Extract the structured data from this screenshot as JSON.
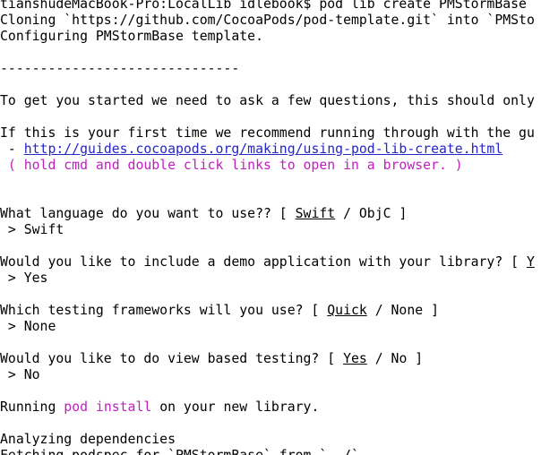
{
  "terminal": {
    "prompt": "tianshudeMacBook-Pro:LocalLib idlebook$ pod lib create PMStormBase",
    "cloning": "Cloning `https://github.com/CocoaPods/pod-template.git` into `PMSto",
    "configuring": "Configuring PMStormBase template.",
    "separator": "------------------------------",
    "intro": "To get you started we need to ask a few questions, this should only",
    "first_time": "If this is your first time we recommend running through with the gu",
    "guide_dash": " - ",
    "guide_link": "http://guides.cocoapods.org/making/using-pod-lib-create.html",
    "hint": " ( hold cmd and double click links to open in a browser. )",
    "q_language": {
      "prefix": "What language do you want to use?? [ ",
      "default": "Swift",
      "suffix": " / ObjC ]",
      "answer": " > Swift"
    },
    "q_demo": {
      "prefix": "Would you like to include a demo application with your library? [ ",
      "default": "Y",
      "answer": " > Yes"
    },
    "q_testing": {
      "prefix": "Which testing frameworks will you use? [ ",
      "default": "Quick",
      "suffix": " / None ]",
      "answer": " > None"
    },
    "q_viewtest": {
      "prefix": "Would you like to do view based testing? [ ",
      "default": "Yes",
      "suffix": " / No ]",
      "answer": " > No"
    },
    "running": {
      "prefix": "Running ",
      "command": "pod install",
      "suffix": " on your new library."
    },
    "analyzing": "Analyzing dependencies",
    "fetching": "Fetching podspec for `PMStormBase` from `../`"
  },
  "colors": {
    "background": "#ffffff",
    "text": "#000000",
    "magenta": "#c01fc0",
    "link": "#2525c8"
  }
}
